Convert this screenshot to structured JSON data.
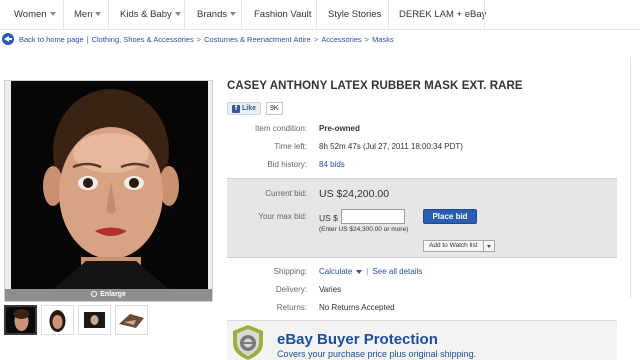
{
  "nav": {
    "items": [
      {
        "label": "Women",
        "dropdown": true
      },
      {
        "label": "Men",
        "dropdown": true
      },
      {
        "label": "Kids & Baby",
        "dropdown": true
      },
      {
        "label": "Brands",
        "dropdown": true
      },
      {
        "label": "Fashion Vault",
        "dropdown": false
      },
      {
        "label": "Style Stories",
        "dropdown": false
      },
      {
        "label": "DEREK LAM + eBay",
        "dropdown": false
      }
    ]
  },
  "breadcrumb": {
    "back_label": "Back to home page",
    "separator": "|",
    "crumbs": [
      "Clothing, Shoes & Accessories",
      "Costumes & Reenactment Attire",
      "Accessories",
      "Masks"
    ],
    "crumb_sep": ">"
  },
  "gallery": {
    "enlarge_label": "Enlarge",
    "thumbnail_count": 4
  },
  "item": {
    "title": "CASEY ANTHONY LATEX RUBBER MASK EXT. RARE",
    "like_label": "Like",
    "like_count": "9K",
    "condition_label": "Item condition:",
    "condition_value": "Pre-owned",
    "time_left_label": "Time left:",
    "time_left_value": "8h 52m 47s (Jul 27, 2011 18:00:34 PDT)",
    "bid_history_label": "Bid history:",
    "bid_history_value": "84 bids"
  },
  "bid": {
    "current_label": "Current bid:",
    "current_value": "US $24,200.00",
    "max_label": "Your max bid:",
    "max_prefix": "US $",
    "max_input_value": "",
    "place_bid_label": "Place bid",
    "hint": "(Enter US $24,300.00 or more)",
    "watch_label": "Add to Watch list"
  },
  "shipping": {
    "shipping_label": "Shipping:",
    "calculate_label": "Calculate",
    "see_all_label": "See all details",
    "delivery_label": "Delivery:",
    "delivery_value": "Varies",
    "returns_label": "Returns:",
    "returns_value": "No Returns Accepted"
  },
  "protection": {
    "title": "eBay Buyer Protection",
    "subtitle": "Covers your purchase price plus original shipping."
  },
  "colors": {
    "link": "#2b4fa3",
    "place_bid": "#2a5db0",
    "protection_text": "#1d4e9c"
  }
}
